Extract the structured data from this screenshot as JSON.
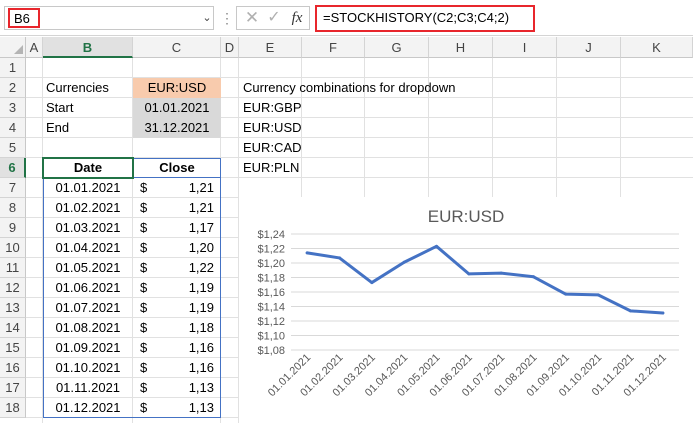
{
  "formula_bar": {
    "name_box": "B6",
    "formula": "=STOCKHISTORY(C2;C3;C4;2)",
    "fx_label": "fx"
  },
  "columns": [
    "A",
    "B",
    "C",
    "D",
    "E",
    "F",
    "G",
    "H",
    "I",
    "J",
    "K"
  ],
  "rows": [
    "1",
    "2",
    "3",
    "4",
    "5",
    "6",
    "7",
    "8",
    "9",
    "10",
    "11",
    "12",
    "13",
    "14",
    "15",
    "16",
    "17",
    "18"
  ],
  "selected_cell": {
    "column": "B",
    "row": "6"
  },
  "params": {
    "currencies_label": "Currencies",
    "currencies_value": "EUR:USD",
    "start_label": "Start",
    "start_value": "01.01.2021",
    "end_label": "End",
    "end_value": "31.12.2021"
  },
  "dropdown": {
    "title": "Currency combinations for dropdown",
    "items": [
      "EUR:GBP",
      "EUR:USD",
      "EUR:CAD",
      "EUR:PLN"
    ]
  },
  "table": {
    "headers": {
      "date": "Date",
      "close": "Close"
    },
    "currency_symbol": "$",
    "rows": [
      {
        "date": "01.01.2021",
        "close": "1,21"
      },
      {
        "date": "01.02.2021",
        "close": "1,21"
      },
      {
        "date": "01.03.2021",
        "close": "1,17"
      },
      {
        "date": "01.04.2021",
        "close": "1,20"
      },
      {
        "date": "01.05.2021",
        "close": "1,22"
      },
      {
        "date": "01.06.2021",
        "close": "1,19"
      },
      {
        "date": "01.07.2021",
        "close": "1,19"
      },
      {
        "date": "01.08.2021",
        "close": "1,18"
      },
      {
        "date": "01.09.2021",
        "close": "1,16"
      },
      {
        "date": "01.10.2021",
        "close": "1,16"
      },
      {
        "date": "01.11.2021",
        "close": "1,13"
      },
      {
        "date": "01.12.2021",
        "close": "1,13"
      }
    ]
  },
  "colors": {
    "selection_green": "#217346",
    "highlight_red": "#e8262c",
    "input_orange": "#f8cbad",
    "input_gray": "#d9d9d9",
    "series_blue": "#4472c4"
  },
  "chart_data": {
    "type": "line",
    "title": "EUR:USD",
    "categories": [
      "01.01.2021",
      "01.02.2021",
      "01.03.2021",
      "01.04.2021",
      "01.05.2021",
      "01.06.2021",
      "01.07.2021",
      "01.08.2021",
      "01.09.2021",
      "01.10.2021",
      "01.11.2021",
      "01.12.2021"
    ],
    "series": [
      {
        "values": [
          1.214,
          1.207,
          1.173,
          1.201,
          1.223,
          1.185,
          1.186,
          1.181,
          1.157,
          1.156,
          1.134,
          1.131
        ]
      }
    ],
    "ylim": [
      1.08,
      1.24
    ],
    "yticks": [
      "$1,08",
      "$1,10",
      "$1,12",
      "$1,14",
      "$1,16",
      "$1,18",
      "$1,20",
      "$1,22",
      "$1,24"
    ],
    "grid": true,
    "legend": "none"
  }
}
